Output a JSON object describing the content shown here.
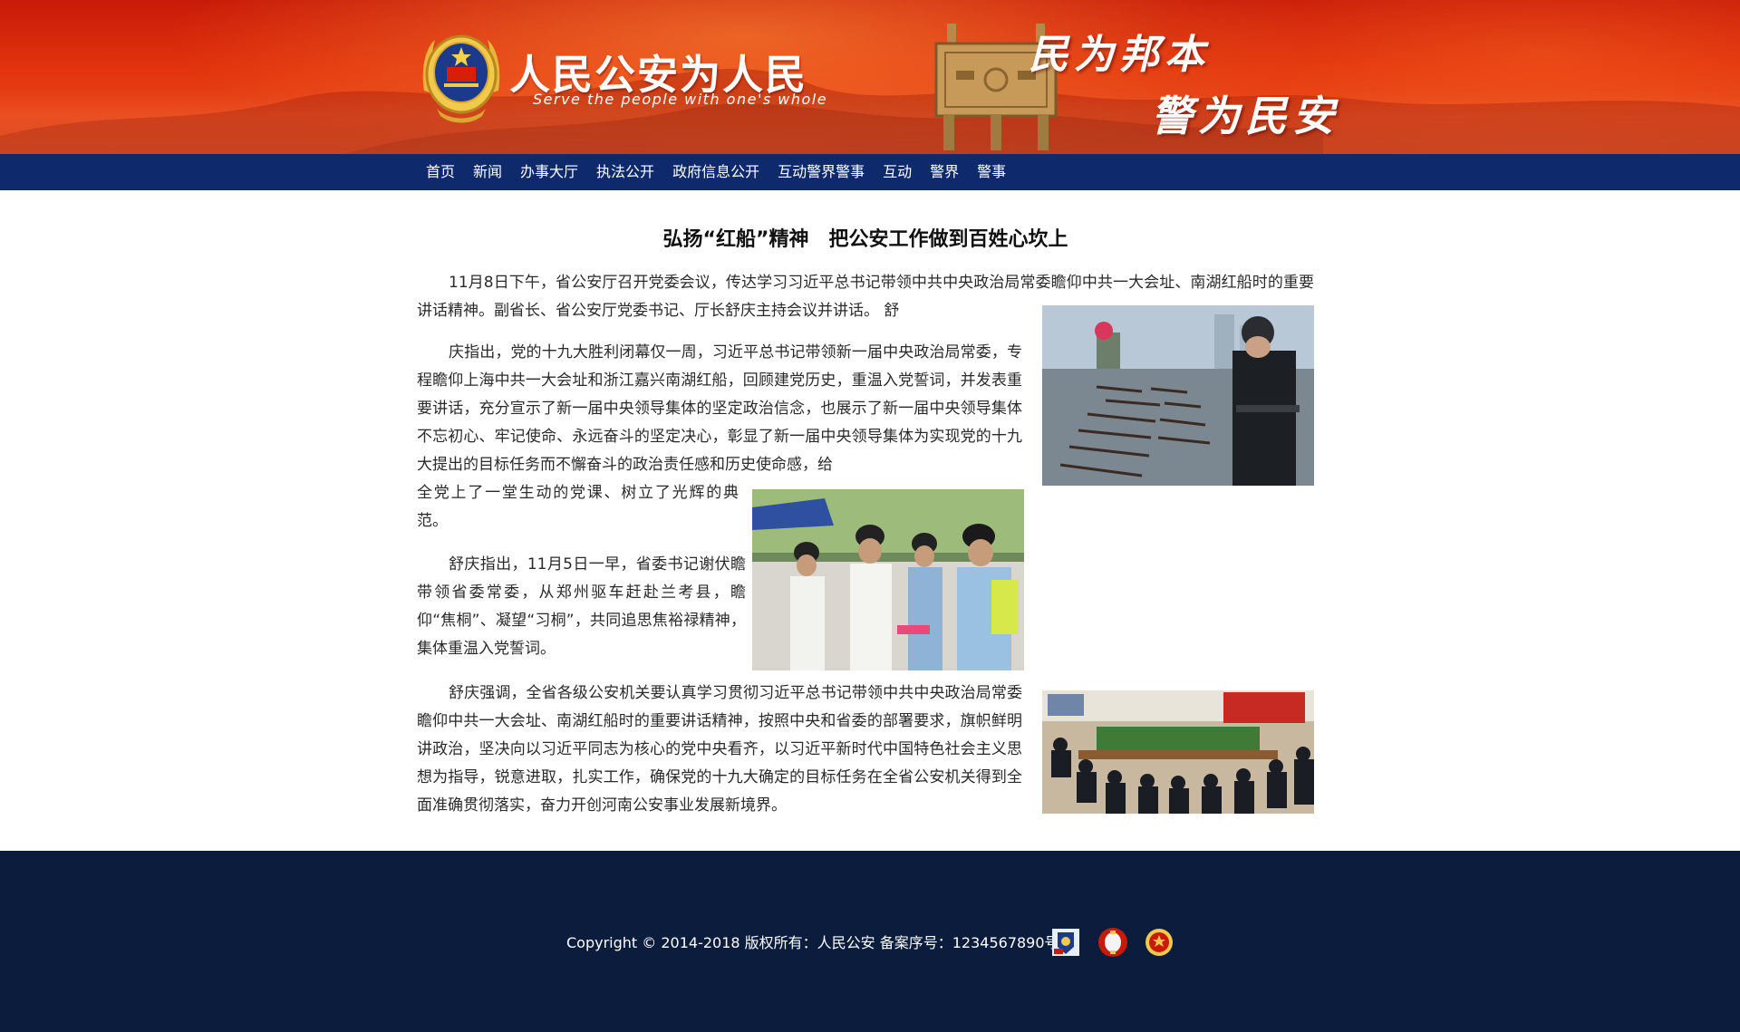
{
  "header": {
    "title": "人民公安为人民",
    "subtitle": "Serve the people with one's whole",
    "slogan_line1": "民为邦本",
    "slogan_line2": "警为民安"
  },
  "nav": {
    "items": [
      {
        "label": "首页"
      },
      {
        "label": "新闻"
      },
      {
        "label": "办事大厅"
      },
      {
        "label": "执法公开"
      },
      {
        "label": "政府信息公开"
      },
      {
        "label": "互动警界警事"
      },
      {
        "label": "互动"
      },
      {
        "label": "警界"
      },
      {
        "label": "警事"
      }
    ]
  },
  "article": {
    "title": "弘扬“红船”精神　把公安工作做到百姓心坎上",
    "paragraphs": [
      "11月8日下午，省公安厅召开党委会议，传达学习习近平总书记带领中共中央政治局常委瞻仰中共一大会址、南湖红船时的重要讲话精神。副省长、省公安厅党委书记、厅长舒庆主持会议并讲话。 舒",
      "庆指出，党的十九大胜利闭幕仅一周，习近平总书记带领新一届中央政治局常委，专程瞻仰上海中共一大会址和浙江嘉兴南湖红船，回顾建党历史，重温入党誓词，并发表重要讲话，充分宣示了新一届中央领导集体的坚定政治信念，也展示了新一届中央领导集体不忘初心、牢记使命、永远奋斗的坚定决心，彰显了新一届中央领导集体为实现党的十九大提出的目标任务而不懈奋斗的政治责任感和历史使命感，给",
      "全党上了一堂生动的党课、树立了光辉的典范。",
      "舒庆指出，11月5日一早，省委书记谢伏瞻带领省委常委，从郑州驱车赶赴兰考县，瞻仰“焦桐”、凝望“习桐”，共同追思焦裕禄精神，集体重温入党誓词。",
      "舒庆强调，全省各级公安机关要认真学习贯彻习近平总书记带领中共中央政治局常委瞻仰中共一大会址、南湖红船时的重要讲话精神，按照中央和省委的部署要求，旗帜鲜明讲政治，坚决向以习近平同志为核心的党中央看齐，以习近平新时代中国特色社会主义思想为指导，锐意进取，扎实工作，确保党的十九大确定的目标任务在全省公安机关得到全面准确贯彻落实，奋力开创河南公安事业发展新境界。"
    ]
  },
  "footer": {
    "copyright": "Copyright © 2014-2018 版权所有：人民公安 备案序号：1234567890号"
  },
  "colors": {
    "banner_red": "#d9300c",
    "nav_blue": "#0e2a6d",
    "footer_navy": "#0b1c3d"
  },
  "icons": [
    "police-emblem-icon",
    "bronze-ding-icon",
    "police-badge-icon",
    "lantern-icon",
    "national-emblem-icon"
  ]
}
